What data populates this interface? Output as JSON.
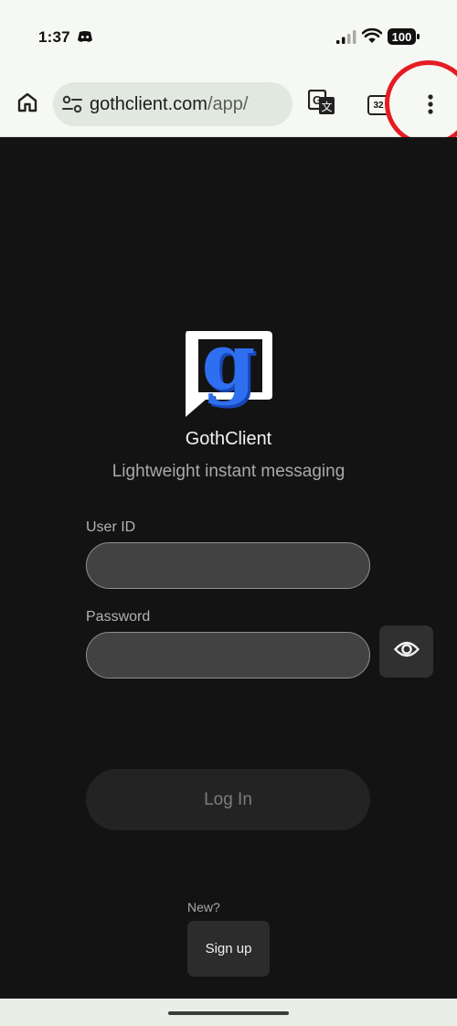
{
  "status_bar": {
    "time": "1:37",
    "battery": "100",
    "icons": [
      "discord-icon",
      "signal-icon",
      "wifi-icon",
      "battery-icon"
    ]
  },
  "browser": {
    "url_host": "gothclient.com",
    "url_path": "/app/",
    "tab_count": "32",
    "icons": [
      "home-icon",
      "site-settings-icon",
      "translate-icon",
      "tabs-icon",
      "more-vert-icon"
    ]
  },
  "app": {
    "name": "GothClient",
    "tagline": "Lightweight instant messaging",
    "logo_letter": "g",
    "user_id_label": "User ID",
    "user_id_value": "",
    "password_label": "Password",
    "password_value": "",
    "login_label": "Log In",
    "new_label": "New?",
    "signup_label": "Sign up"
  },
  "colors": {
    "app_background": "#131313",
    "logo_blue": "#1f5fe0",
    "annotation_red": "#e51c23",
    "toolbar_background": "#f6f8f3"
  }
}
